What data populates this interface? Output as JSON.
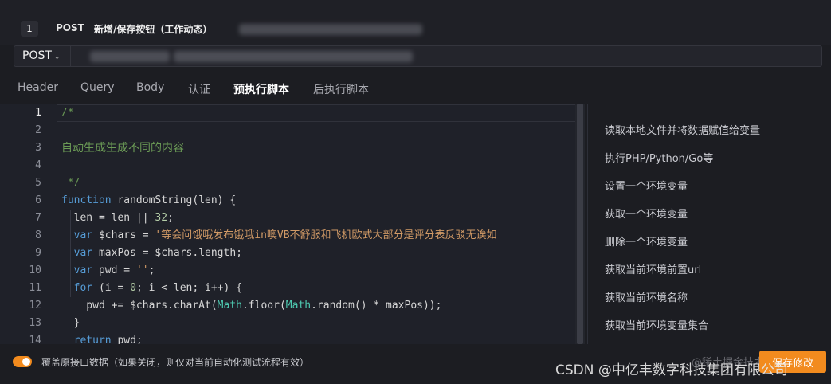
{
  "step": {
    "index": "1",
    "method": "POST",
    "title": "新增/保存按钮（工作动态）"
  },
  "url_bar": {
    "method": "POST"
  },
  "tabs": [
    {
      "label": "Header",
      "active": false
    },
    {
      "label": "Query",
      "active": false
    },
    {
      "label": "Body",
      "active": false
    },
    {
      "label": "认证",
      "active": false
    },
    {
      "label": "预执行脚本",
      "active": true
    },
    {
      "label": "后执行脚本",
      "active": false
    }
  ],
  "editor": {
    "line_numbers": [
      "1",
      "2",
      "3",
      "4",
      "5",
      "6",
      "7",
      "8",
      "9",
      "10",
      "11",
      "12",
      "13",
      "14"
    ],
    "active_line": "1",
    "lines": {
      "l1": "/*",
      "l3": "自动生成生成不同的内容",
      "l5": " */",
      "l6_kw": "function",
      "l6_rest": " randomString(len) {",
      "l7_a": "  len = len || ",
      "l7_num": "32",
      "l7_b": ";",
      "l8_kw": "  var",
      "l8_a": " $chars = ",
      "l8_str": "'等会问饿哦发布饿哦in噢VB不舒服和飞机欧式大部分是评分表反驳无诶如",
      "l9_kw": "  var",
      "l9_a": " maxPos = $chars.length;",
      "l10_kw": "  var",
      "l10_a": " pwd = ",
      "l10_str": "''",
      "l10_b": ";",
      "l11_kw": "  for",
      "l11_a": " (i = ",
      "l11_num": "0",
      "l11_b": "; i < len; i++) {",
      "l12_a": "    pwd += $chars.charAt(",
      "l12_cls1": "Math",
      "l12_b": ".floor(",
      "l12_cls2": "Math",
      "l12_c": ".random() * maxPos));",
      "l13": "  }",
      "l14_kw": "  return",
      "l14_a": " pwd;"
    }
  },
  "snippets": [
    "读取本地文件并将数据赋值给变量",
    "执行PHP/Python/Go等",
    "设置一个环境变量",
    "获取一个环境变量",
    "删除一个环境变量",
    "获取当前环境前置url",
    "获取当前环境名称",
    "获取当前环境变量集合"
  ],
  "footer": {
    "toggle_on": true,
    "override_label": "覆盖原接口数据（如果关闭，则仅对当前自动化测试流程有效）",
    "save_label": "保存修改",
    "watermark_juejin": "@稀土掘金技术社区",
    "watermark_csdn": "CSDN @中亿丰数字科技集团有限公司"
  },
  "colors": {
    "accent": "#f28b1e",
    "background": "#1c1d22"
  }
}
